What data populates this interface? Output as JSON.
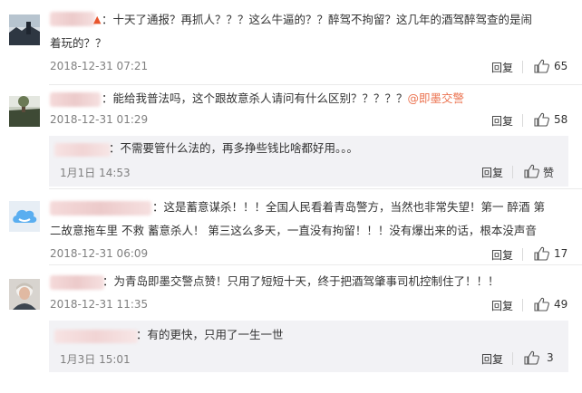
{
  "comments": [
    {
      "text_line1": "：十天了通报？再抓人？？？这么牛逼的？？醉驾不拘留？这几年的酒驾醉驾查的是闹",
      "text_line2": "着玩的？？",
      "time": "2018-12-31 07:21",
      "reply_label": "回复",
      "likes": "65"
    },
    {
      "text": "：能给我普法吗，这个跟故意杀人请问有什么区别？？？？？",
      "mention": "@即墨交警",
      "time": "2018-12-31 01:29",
      "reply_label": "回复",
      "likes": "58",
      "sub_reply": {
        "text": "：不需要管什么法的，再多挣些钱比啥都好用。。。",
        "time": "1月1日 14:53",
        "reply_label": "回复",
        "like_label": "赞"
      }
    },
    {
      "text_line1": "：这是蓄意谋杀！！！全国人民看着青岛警方，当然也非常失望！第一 醉酒 第",
      "text_line2": "二故意拖车里 不救 蓄意杀人！ 第三这么多天，一直没有拘留！！！没有爆出来的话，根本没声音",
      "time": "2018-12-31 06:09",
      "reply_label": "回复",
      "likes": "17"
    },
    {
      "text": "：为青岛即墨交警点赞！只用了短短十天，终于把酒驾肇事司机控制住了！！！",
      "time": "2018-12-31 11:35",
      "reply_label": "回复",
      "likes": "49",
      "sub_reply": {
        "text": "：有的更快，只用了一生一世",
        "time": "1月3日 15:01",
        "reply_label": "回复",
        "likes": "3"
      }
    }
  ]
}
